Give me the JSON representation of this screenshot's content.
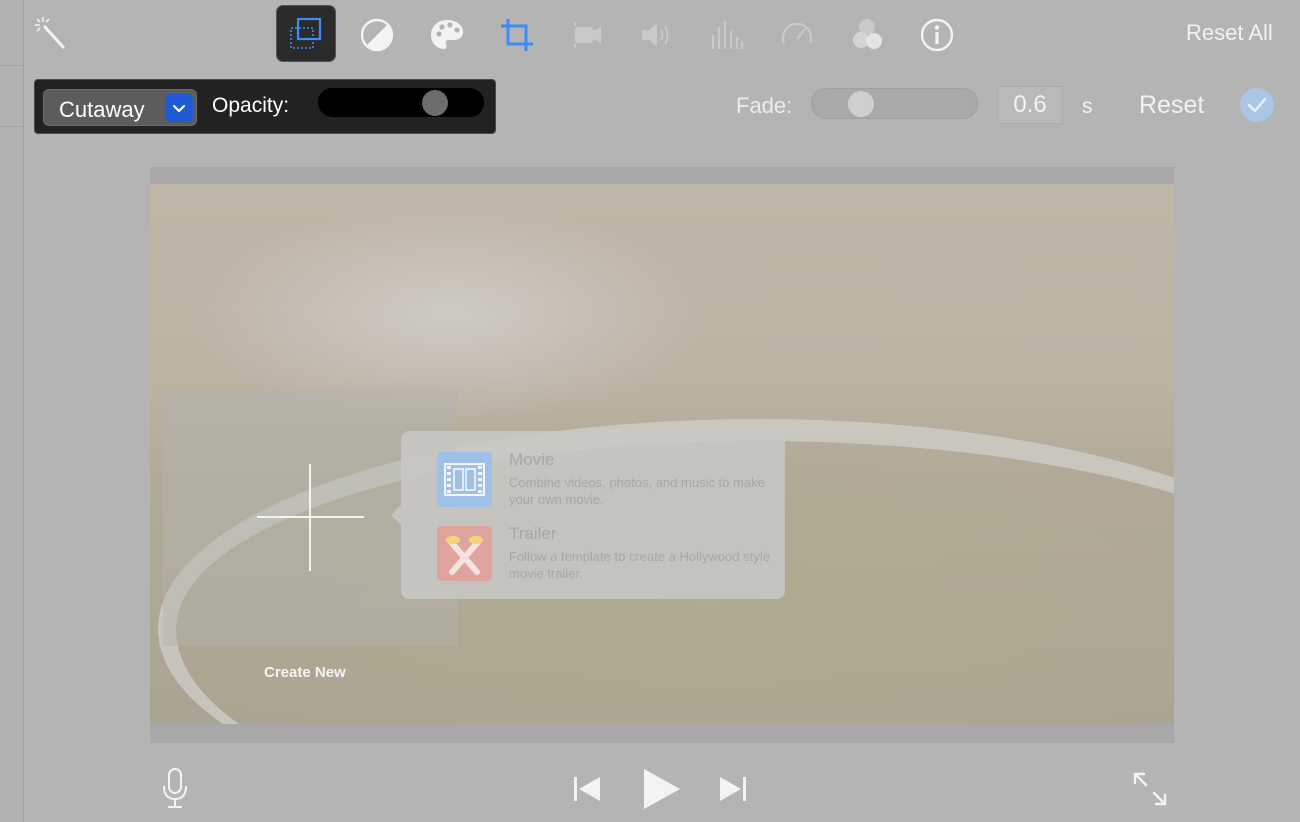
{
  "toolbar": {
    "tools": [
      {
        "name": "magic-wand-icon",
        "active": false
      },
      {
        "name": "cutaway-crop-icon",
        "active": true
      },
      {
        "name": "color-balance-icon",
        "active": false
      },
      {
        "name": "color-palette-icon",
        "active": false
      },
      {
        "name": "crop-icon",
        "active": false
      },
      {
        "name": "stabilization-icon",
        "active": false
      },
      {
        "name": "volume-icon",
        "active": false
      },
      {
        "name": "equalizer-icon",
        "active": false
      },
      {
        "name": "speed-icon",
        "active": false
      },
      {
        "name": "filter-icon",
        "active": false
      },
      {
        "name": "info-icon",
        "active": false
      }
    ],
    "reset_all_label": "Reset All"
  },
  "cutaway": {
    "mode_label": "Cutaway",
    "opacity_label": "Opacity:",
    "opacity_fraction": 0.75
  },
  "fade": {
    "label": "Fade:",
    "value": "0.6",
    "unit": "s",
    "slider_fraction": 0.25
  },
  "reset_label": "Reset",
  "create_new": {
    "label": "Create New",
    "options": [
      {
        "title": "Movie",
        "description": "Combine videos, photos, and music to make your own movie.",
        "icon": "film-strip-icon"
      },
      {
        "title": "Trailer",
        "description": "Follow a template to create a Hollywood style movie trailer.",
        "icon": "trailer-spotlight-icon"
      }
    ]
  },
  "colors": {
    "accent_blue": "#1e5ad6",
    "confirm_blue": "#a9c6e6",
    "trailer_red": "#e0a49e"
  }
}
